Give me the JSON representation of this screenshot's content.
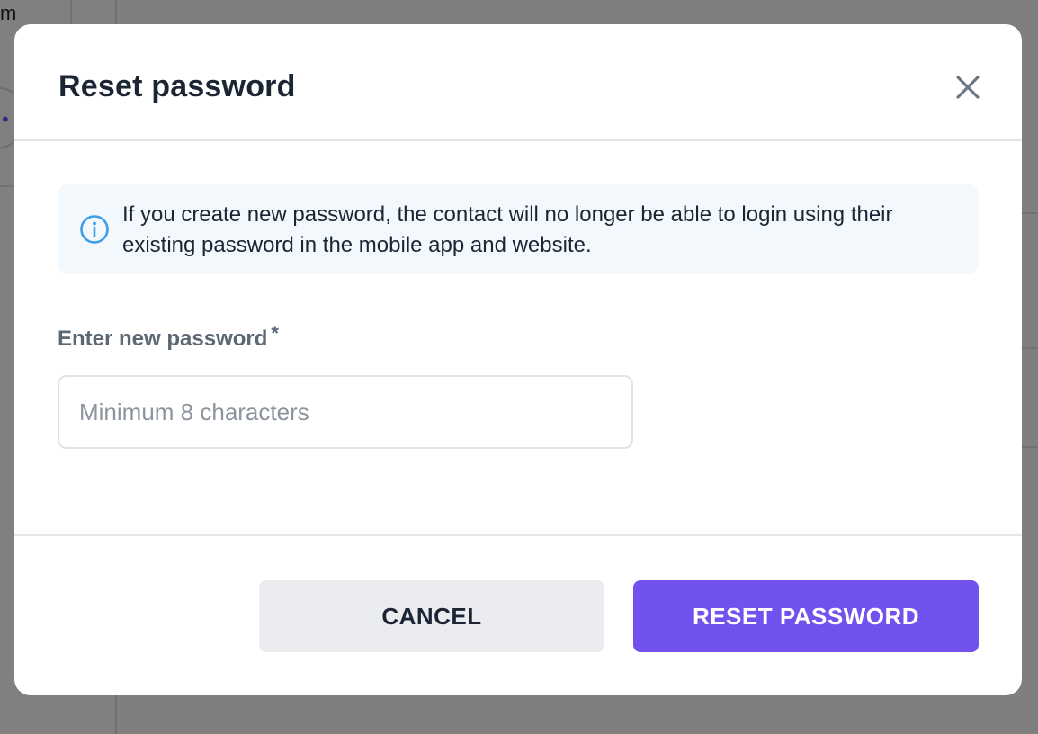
{
  "background": {
    "partial_text": "m",
    "dots": "• •"
  },
  "modal": {
    "title": "Reset password",
    "close_icon": "close-icon",
    "info": {
      "icon": "info-icon",
      "text": "If you create new password, the contact will no longer be able to login using their existing password in the mobile app and website."
    },
    "field": {
      "label": "Enter new password",
      "required_mark": "*",
      "placeholder": "Minimum 8 characters",
      "value": ""
    },
    "buttons": {
      "cancel_label": "CANCEL",
      "reset_label": "RESET PASSWORD"
    }
  },
  "colors": {
    "primary": "#7252ee",
    "info_bg": "#f3f8fc",
    "info_icon": "#3b9ee6",
    "title": "#1c2534",
    "label": "#5d6876"
  }
}
